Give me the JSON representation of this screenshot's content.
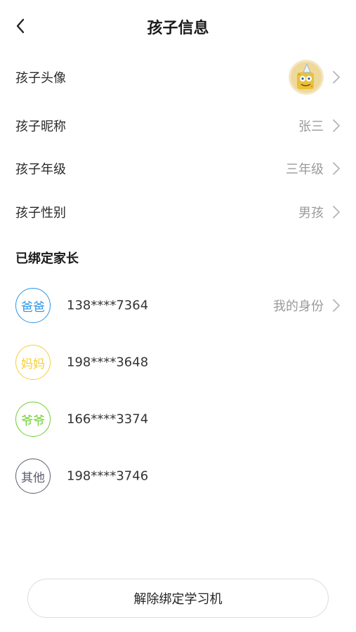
{
  "header": {
    "title": "孩子信息"
  },
  "child": {
    "avatar_label": "孩子头像",
    "nickname_label": "孩子昵称",
    "nickname_value": "张三",
    "grade_label": "孩子年级",
    "grade_value": "三年级",
    "gender_label": "孩子性别",
    "gender_value": "男孩"
  },
  "parents": {
    "section_title": "已绑定家长",
    "items": [
      {
        "role": "爸爸",
        "phone": "138****7364",
        "extra": "我的身份",
        "color": "#2d95e6"
      },
      {
        "role": "妈妈",
        "phone": "198****3648",
        "color": "#f5cf3d"
      },
      {
        "role": "爷爷",
        "phone": "166****3374",
        "color": "#6fcf2f"
      },
      {
        "role": "其他",
        "phone": "198****3746",
        "color": "#5c5f70"
      }
    ]
  },
  "unbind_button": "解除绑定学习机"
}
